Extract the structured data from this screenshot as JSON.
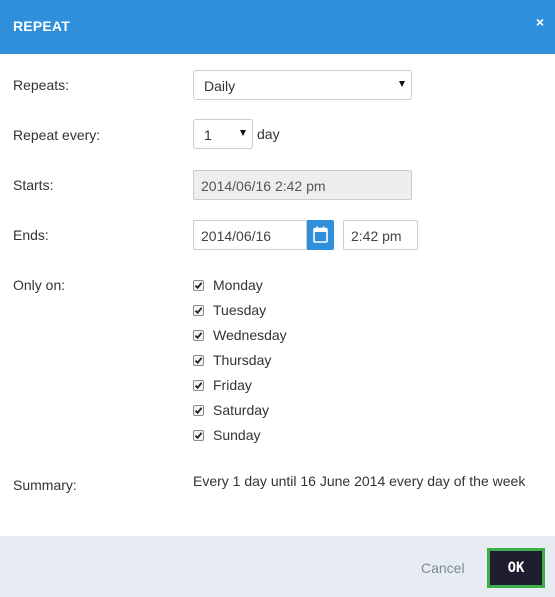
{
  "header": {
    "title": "REPEAT",
    "close_label": "×"
  },
  "form": {
    "repeats_label": "Repeats:",
    "repeats_value": "Daily",
    "repeat_every_label": "Repeat every:",
    "repeat_every_value": "1",
    "repeat_every_unit": "day",
    "starts_label": "Starts:",
    "starts_value": "2014/06/16 2:42 pm",
    "ends_label": "Ends:",
    "ends_date": "2014/06/16",
    "ends_time": "2:42 pm",
    "only_on_label": "Only on:",
    "days": [
      {
        "label": "Monday",
        "checked": true
      },
      {
        "label": "Tuesday",
        "checked": true
      },
      {
        "label": "Wednesday",
        "checked": true
      },
      {
        "label": "Thursday",
        "checked": true
      },
      {
        "label": "Friday",
        "checked": true
      },
      {
        "label": "Saturday",
        "checked": true
      },
      {
        "label": "Sunday",
        "checked": true
      }
    ],
    "summary_label": "Summary:",
    "summary_value": "Every 1 day until 16 June 2014 every day of the week"
  },
  "footer": {
    "cancel_label": "Cancel",
    "ok_label": "OK"
  },
  "colors": {
    "header_bg": "#2f8fdb",
    "footer_bg": "#e6ecf2",
    "ok_bg": "#1e1e2e",
    "ok_border": "#3cae4a"
  },
  "icons": {
    "close": "close-icon",
    "calendar": "calendar-icon",
    "caret": "caret-down-icon",
    "checkmark": "checkmark-icon"
  }
}
